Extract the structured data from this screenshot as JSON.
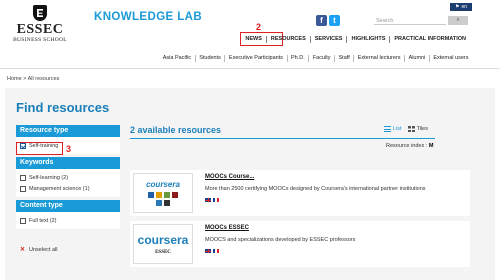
{
  "header": {
    "logo_word": "ESSEC",
    "logo_sub": "BUSINESS SCHOOL",
    "site_title": "KNOWLEDGE LAB",
    "search_placeholder": "Search",
    "lang_label": "en",
    "top_nav": [
      "NEWS",
      "RESOURCES",
      "SERVICES",
      "HIGHLIGHTS",
      "PRACTICAL INFORMATION"
    ],
    "sub_nav": [
      "Asia Pacific",
      "Students",
      "Executive Participants",
      "Ph.D.",
      "Faculty",
      "Staff",
      "External lecturers",
      "Alumni",
      "External users"
    ]
  },
  "annotations": {
    "resources": "2",
    "self_training": "3"
  },
  "breadcrumb": "Home > All resources",
  "page_title": "Find resources",
  "sidebar": {
    "sections": [
      {
        "title": "Resource type",
        "options": [
          {
            "label": "Self-training",
            "checked": true
          }
        ]
      },
      {
        "title": "Keywords",
        "options": [
          {
            "label": "Self-learning (2)",
            "checked": false
          },
          {
            "label": "Management science (1)",
            "checked": false
          }
        ]
      },
      {
        "title": "Content type",
        "options": [
          {
            "label": "Full text (2)",
            "checked": false
          }
        ]
      }
    ],
    "unselect_label": "Unselect all"
  },
  "results": {
    "title": "2 available resources",
    "view_list": "List",
    "view_tiles": "Tiles",
    "index_label": "Resource index :",
    "index_letter": "M",
    "items": [
      {
        "title": "MOOCs Course...",
        "description": "More than 2500 certifying MOOCs designed by Coursera's international partner institutions",
        "thumb_text": "coursera"
      },
      {
        "title": "MOOCs ESSEC",
        "description": "MOOCS and specializations developed by ESSEC professors",
        "thumb_text": "coursera",
        "thumb_sub": "ESSEC"
      }
    ]
  },
  "colors": {
    "accent": "#1a9ad6",
    "title": "#1a7fb9",
    "annotation": "#e02020"
  }
}
